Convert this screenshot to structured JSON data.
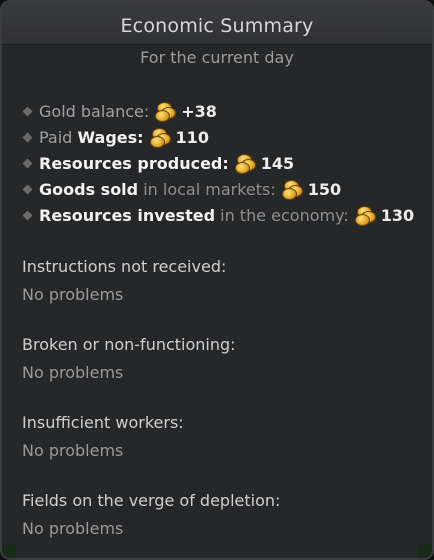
{
  "header": {
    "title": "Economic Summary",
    "subtitle": "For the current day"
  },
  "stats": [
    {
      "icon": "gold-coins-icon",
      "parts": [
        {
          "text": "Gold balance:",
          "style": "normal"
        }
      ],
      "value": "+38"
    },
    {
      "icon": "gold-coins-icon",
      "parts": [
        {
          "text": "Paid",
          "style": "normal"
        },
        {
          "text": "Wages:",
          "style": "strong"
        }
      ],
      "value": "110"
    },
    {
      "icon": "gold-coins-icon",
      "parts": [
        {
          "text": "Resources produced:",
          "style": "strong"
        }
      ],
      "value": "145"
    },
    {
      "icon": "gold-coins-icon",
      "parts": [
        {
          "text": "Goods sold",
          "style": "strong"
        },
        {
          "text": "in local markets:",
          "style": "dim"
        }
      ],
      "value": "150"
    },
    {
      "icon": "gold-coins-icon",
      "parts": [
        {
          "text": "Resources invested",
          "style": "strong"
        },
        {
          "text": "in the economy:",
          "style": "dim"
        }
      ],
      "value": "130"
    }
  ],
  "sections": [
    {
      "title": "Instructions not received:",
      "value": "No problems"
    },
    {
      "title": "Broken or non-functioning:",
      "value": "No problems"
    },
    {
      "title": "Insufficient workers:",
      "value": "No problems"
    },
    {
      "title": "Fields on the verge of depletion:",
      "value": "No problems"
    }
  ],
  "colors": {
    "panel_bg": "#262729",
    "header_bg": "#3a3b3e",
    "text_strong": "#f2f2f2",
    "text_normal": "#a1a1a1",
    "gold": "#e0a426"
  }
}
